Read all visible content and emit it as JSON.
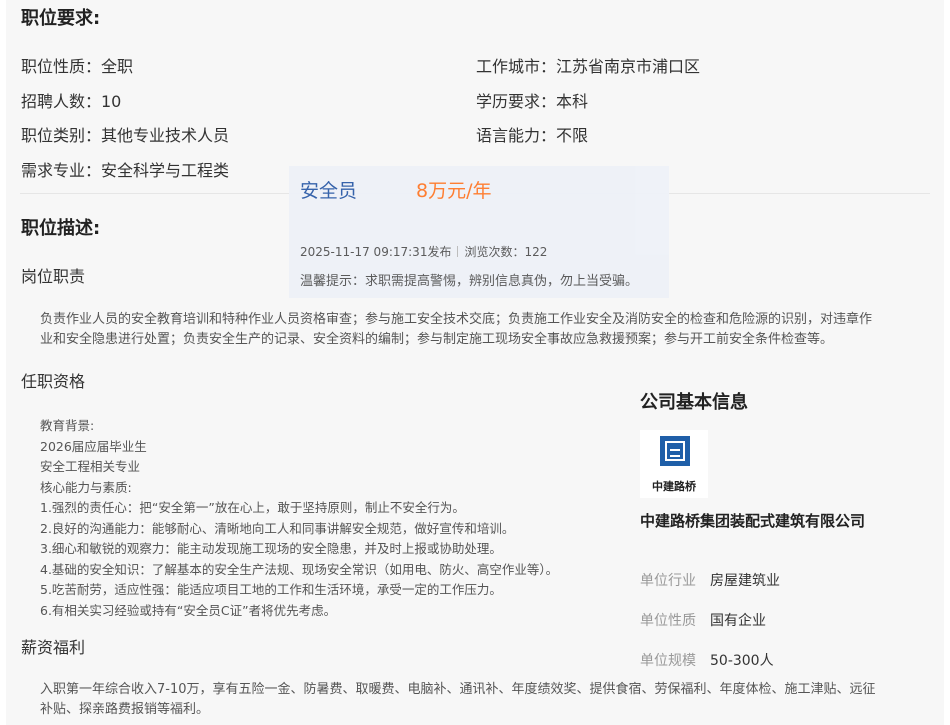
{
  "requirements": {
    "title": "职位要求:",
    "left": [
      "职位性质：全职",
      "招聘人数：10",
      "职位类别：其他专业技术人员",
      "需求专业：安全科学与工程类"
    ],
    "right": [
      "工作城市：江苏省南京市浦口区",
      "学历要求：本科",
      "语言能力：不限"
    ]
  },
  "job_card": {
    "title": "安全员",
    "salary": "8万元/年",
    "posted": "2025-11-17 09:17:31发布",
    "views": "浏览次数：122",
    "tip": "温馨提示：求职需提高警惕，辨别信息真伪，勿上当受骗。"
  },
  "description": {
    "title": "职位描述:",
    "duties_title": "岗位职责",
    "duties_lines": [
      "负责作业人员的安全教育培训和特种作业人员资格审查；参与施工安全技术交底；负责施工作业安全及消防安全的检查和危险源的识别，对违章作",
      "业和安全隐患进行处置；负责安全生产的记录、安全资料的编制；参与制定施工现场安全事故应急救援预案；参与开工前安全条件检查等。"
    ],
    "qualifications_title": "任职资格",
    "qualifications_lines": [
      "教育背景:",
      "2026届应届毕业生",
      "安全工程相关专业",
      "核心能力与素质:",
      "1.强烈的责任心：把“安全第一”放在心上，敢于坚持原则，制止不安全行为。",
      "2.良好的沟通能力：能够耐心、清晰地向工人和同事讲解安全规范，做好宣传和培训。",
      "3.细心和敏锐的观察力：能主动发现施工现场的安全隐患，并及时上报或协助处理。",
      "4.基础的安全知识：了解基本的安全生产法规、现场安全常识（如用电、防火、高空作业等）。",
      "5.吃苦耐劳，适应性强：能适应项目工地的工作和生活环境，承受一定的工作压力。",
      "6.有相关实习经验或持有“安全员C证”者将优先考虑。"
    ],
    "benefits_title": "薪资福利",
    "benefits_lines": [
      "入职第一年综合收入7-10万，享有五险一金、防暑费、取暖费、电脑补、通讯补、年度绩效奖、提供食宿、劳保福利、年度体检、施工津贴、远征",
      "补贴、探亲路费报销等福利。"
    ]
  },
  "company": {
    "title": "公司基本信息",
    "logo_text": "中建路桥",
    "name": "中建路桥集团装配式建筑有限公司",
    "industry_label": "单位行业",
    "industry": "房屋建筑业",
    "nature_label": "单位性质",
    "nature": "国有企业",
    "size_label": "单位规模",
    "size": "50-300人"
  },
  "colors": {
    "accent_blue": "#2f5ea8",
    "salary_orange": "#ff7a2a",
    "logo_blue": "#1f5fa8"
  }
}
